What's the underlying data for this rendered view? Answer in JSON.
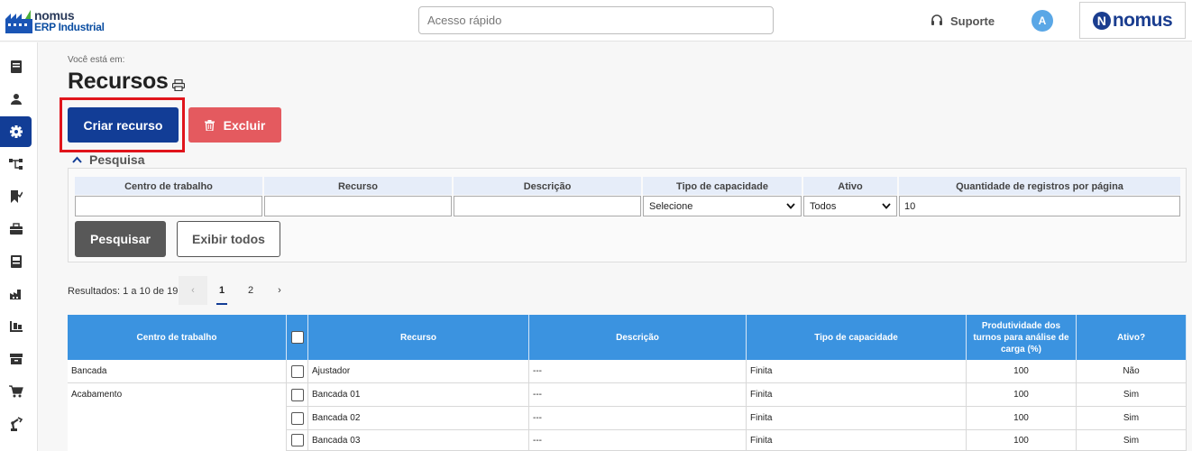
{
  "app": {
    "logo_line1": "nomus",
    "logo_line2": "ERP Industrial",
    "quick_access_placeholder": "Acesso rápido",
    "support_label": "Suporte",
    "avatar_letter": "A",
    "brand_letter": "N",
    "brand_text": "nomus"
  },
  "sidebar": {
    "items": [
      {
        "icon": "book-icon",
        "active": false
      },
      {
        "icon": "user-icon",
        "active": false
      },
      {
        "icon": "gear-icon",
        "active": true
      },
      {
        "icon": "flow-icon",
        "active": false
      },
      {
        "icon": "bookmark-check-icon",
        "active": false
      },
      {
        "icon": "briefcase-icon",
        "active": false
      },
      {
        "icon": "cash-register-icon",
        "active": false
      },
      {
        "icon": "factory-icon",
        "active": false
      },
      {
        "icon": "pallet-icon",
        "active": false
      },
      {
        "icon": "archive-icon",
        "active": false
      },
      {
        "icon": "cart-icon",
        "active": false
      },
      {
        "icon": "robot-arm-icon",
        "active": false
      }
    ]
  },
  "page": {
    "breadcrumb": "Você está em:",
    "title": "Recursos",
    "create_label": "Criar recurso",
    "delete_label": "Excluir"
  },
  "search": {
    "heading": "Pesquisa",
    "fields": {
      "work_center": "Centro de trabalho",
      "resource": "Recurso",
      "description": "Descrição",
      "capacity_type": "Tipo de capacidade",
      "active": "Ativo",
      "page_size": "Quantidade de registros por página"
    },
    "values": {
      "work_center": "",
      "resource": "",
      "description": "",
      "capacity_type": "Selecione",
      "active": "Todos",
      "page_size": "10"
    },
    "search_label": "Pesquisar",
    "show_all_label": "Exibir todos"
  },
  "pagination": {
    "results_text": "Resultados: 1 a 10 de 19.",
    "prev": "‹",
    "pages": [
      "1",
      "2"
    ],
    "current": "1",
    "next": "›"
  },
  "table": {
    "headers": {
      "work_center": "Centro de trabalho",
      "resource": "Recurso",
      "description": "Descrição",
      "capacity_type": "Tipo de capacidade",
      "productivity": "Produtividade dos turnos para análise de carga (%)",
      "active": "Ativo?"
    },
    "rows": [
      {
        "work_center": "Bancada",
        "resource": "Ajustador",
        "description": "---",
        "capacity_type": "Finita",
        "productivity": "100",
        "active": "Não"
      },
      {
        "work_center": "Acabamento",
        "resource": "Bancada 01",
        "description": "---",
        "capacity_type": "Finita",
        "productivity": "100",
        "active": "Sim"
      },
      {
        "work_center": "",
        "resource": "Bancada 02",
        "description": "---",
        "capacity_type": "Finita",
        "productivity": "100",
        "active": "Sim"
      },
      {
        "work_center": "",
        "resource": "Bancada 03",
        "description": "---",
        "capacity_type": "Finita",
        "productivity": "100",
        "active": "Sim"
      }
    ]
  },
  "colors": {
    "primary": "#123d96",
    "danger": "#e45a5f",
    "table_header": "#3b93e0",
    "highlight": "#e0141b"
  }
}
